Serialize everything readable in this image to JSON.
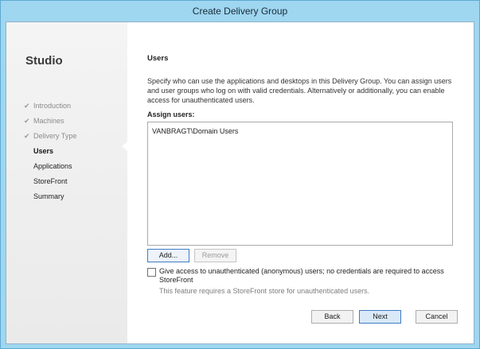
{
  "window": {
    "title": "Create Delivery Group"
  },
  "sidebar": {
    "app_name": "Studio",
    "steps": [
      {
        "label": "Introduction",
        "state": "done"
      },
      {
        "label": "Machines",
        "state": "done"
      },
      {
        "label": "Delivery Type",
        "state": "done"
      },
      {
        "label": "Users",
        "state": "active"
      },
      {
        "label": "Applications",
        "state": "pending"
      },
      {
        "label": "StoreFront",
        "state": "pending"
      },
      {
        "label": "Summary",
        "state": "pending"
      }
    ]
  },
  "main": {
    "heading": "Users",
    "description": "Specify who can use the applications and desktops in this Delivery Group. You can assign users and user groups who log on with valid credentials. Alternatively or additionally, you can enable access for unauthenticated users.",
    "assign_label": "Assign users:",
    "users": [
      "VANBRAGT\\Domain Users"
    ],
    "add_label": "Add...",
    "remove_label": "Remove",
    "anonymous_checkbox_label": "Give access to unauthenticated (anonymous) users; no credentials are required to access StoreFront",
    "anonymous_checked": false,
    "anonymous_note": "This feature requires a StoreFront store for unauthenticated users."
  },
  "footer": {
    "back_label": "Back",
    "next_label": "Next",
    "cancel_label": "Cancel"
  },
  "icons": {
    "done_step": "check-icon"
  },
  "colors": {
    "titlebar": "#9fd6f0",
    "primary_button_border": "#3f7cc4"
  }
}
